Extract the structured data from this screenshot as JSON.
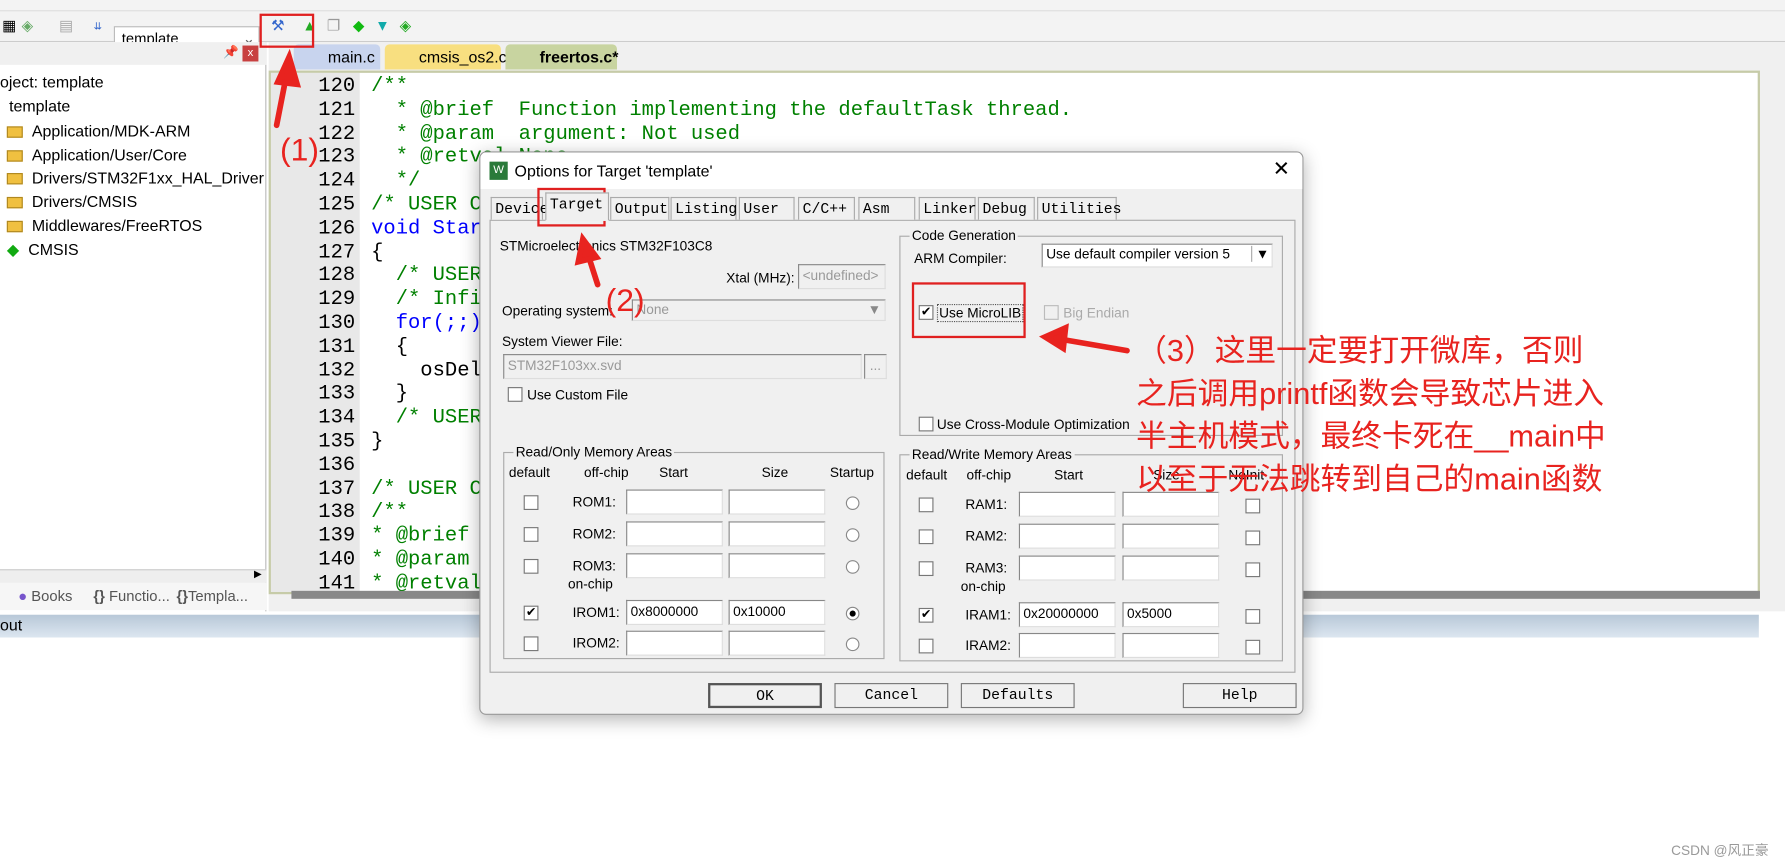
{
  "toolbar": {
    "target_select": "template",
    "options_icon": "magic-wand-icon"
  },
  "project_panel": {
    "root": "oject: template",
    "target": "template",
    "groups": [
      "Application/MDK-ARM",
      "Application/User/Core",
      "Drivers/STM32F1xx_HAL_Driver",
      "Drivers/CMSIS",
      "Middlewares/FreeRTOS",
      "CMSIS"
    ],
    "tabs": [
      "Books",
      "Functio...",
      "Templa..."
    ]
  },
  "editor": {
    "tabs": [
      "main.c",
      "cmsis_os2.c",
      "freertos.c*"
    ],
    "lines": [
      {
        "n": "120",
        "t": "/**",
        "s": "c"
      },
      {
        "n": "121",
        "t": "  * @brief  Function implementing the defaultTask thread.",
        "s": "c"
      },
      {
        "n": "122",
        "t": "  * @param  argument: Not used",
        "s": "c"
      },
      {
        "n": "123",
        "t": "  * @retval None",
        "s": "c"
      },
      {
        "n": "124",
        "t": "  */",
        "s": "c"
      },
      {
        "n": "125",
        "t": "/* USER C",
        "s": "c"
      },
      {
        "n": "126",
        "t": "void Star",
        "s": "k"
      },
      {
        "n": "127",
        "t": "{",
        "s": ""
      },
      {
        "n": "128",
        "t": "  /* USER",
        "s": "c"
      },
      {
        "n": "129",
        "t": "  /* Infi",
        "s": "c"
      },
      {
        "n": "130",
        "t": "  for(;;)",
        "s": "k"
      },
      {
        "n": "131",
        "t": "  {",
        "s": ""
      },
      {
        "n": "132",
        "t": "    osDel",
        "s": ""
      },
      {
        "n": "133",
        "t": "  }",
        "s": ""
      },
      {
        "n": "134",
        "t": "  /* USER",
        "s": "c"
      },
      {
        "n": "135",
        "t": "}",
        "s": ""
      },
      {
        "n": "136",
        "t": "",
        "s": ""
      },
      {
        "n": "137",
        "t": "/* USER C",
        "s": "c"
      },
      {
        "n": "138",
        "t": "/**",
        "s": "c"
      },
      {
        "n": "139",
        "t": "* @brief",
        "s": "c"
      },
      {
        "n": "140",
        "t": "* @param",
        "s": "c"
      },
      {
        "n": "141",
        "t": "* @retval",
        "s": "c"
      }
    ]
  },
  "output_panel": {
    "title": "out"
  },
  "dialog": {
    "title": "Options for Target 'template'",
    "tabs": [
      "Device",
      "Target",
      "Output",
      "Listing",
      "User",
      "C/C++",
      "Asm",
      "Linker",
      "Debug",
      "Utilities"
    ],
    "active_tab": "Target",
    "device": "STMicroelectronics STM32F103C8",
    "xtal_label": "Xtal (MHz):",
    "xtal_value": "<undefined>",
    "os_label": "Operating system:",
    "os_value": "None",
    "svf_label": "System Viewer File:",
    "svf_value": "STM32F103xx.svd",
    "browse": "...",
    "custom_file": "Use Custom File",
    "codegen": {
      "title": "Code Generation",
      "compiler_label": "ARM Compiler:",
      "compiler_value": "Use default compiler version 5",
      "microlib": "Use MicroLIB",
      "microlib_checked": true,
      "big_endian": "Big Endian",
      "cross_module": "Use Cross-Module Optimization"
    },
    "ro": {
      "title": "Read/Only Memory Areas",
      "headers": [
        "default",
        "off-chip",
        "Start",
        "Size",
        "Startup"
      ],
      "on_chip": "on-chip",
      "rows": [
        {
          "name": "ROM1:",
          "start": "",
          "size": "",
          "def": false,
          "sel": false
        },
        {
          "name": "ROM2:",
          "start": "",
          "size": "",
          "def": false,
          "sel": false
        },
        {
          "name": "ROM3:",
          "start": "",
          "size": "",
          "def": false,
          "sel": false
        },
        {
          "name": "IROM1:",
          "start": "0x8000000",
          "size": "0x10000",
          "def": true,
          "sel": true
        },
        {
          "name": "IROM2:",
          "start": "",
          "size": "",
          "def": false,
          "sel": false
        }
      ]
    },
    "rw": {
      "title": "Read/Write Memory Areas",
      "headers": [
        "default",
        "off-chip",
        "Start",
        "Size",
        "NoInit"
      ],
      "on_chip": "on-chip",
      "rows": [
        {
          "name": "RAM1:",
          "start": "",
          "size": "",
          "def": false
        },
        {
          "name": "RAM2:",
          "start": "",
          "size": "",
          "def": false
        },
        {
          "name": "RAM3:",
          "start": "",
          "size": "",
          "def": false
        },
        {
          "name": "IRAM1:",
          "start": "0x20000000",
          "size": "0x5000",
          "def": true
        },
        {
          "name": "IRAM2:",
          "start": "",
          "size": "",
          "def": false
        }
      ]
    },
    "buttons": {
      "ok": "OK",
      "cancel": "Cancel",
      "defaults": "Defaults",
      "help": "Help"
    }
  },
  "annotations": {
    "color": "#e8231f",
    "step1": "(1)",
    "step2": "(2)",
    "note": [
      "（3）这里一定要打开微库，否则",
      "之后调用printf函数会导致芯片进入",
      "半主机模式，最终卡死在__main中",
      "以至于无法跳转到自己的main函数"
    ]
  },
  "watermark": "CSDN @风正豪"
}
